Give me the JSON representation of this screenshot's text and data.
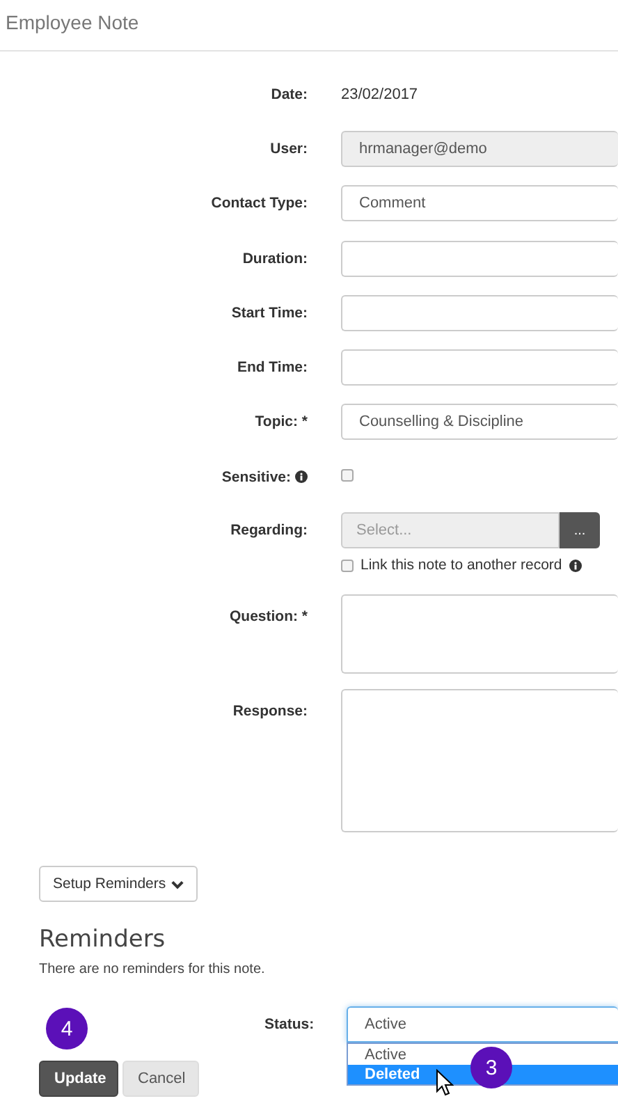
{
  "title": "Employee Note",
  "fields": [
    {
      "label": "Date:",
      "kind": "text",
      "value": "23/02/2017"
    },
    {
      "label": "User:",
      "kind": "readonly",
      "value": "hrmanager@demo"
    },
    {
      "label": "Contact Type:",
      "kind": "input",
      "value": "Comment"
    },
    {
      "label": "Duration:",
      "kind": "input"
    },
    {
      "label": "Start Time:",
      "kind": "input"
    },
    {
      "label": "End Time:",
      "kind": "input"
    },
    {
      "label": "Topic: *",
      "kind": "input",
      "value": "Counselling & Discipline"
    },
    {
      "label": "Sensitive:",
      "kind": "checkbox",
      "info": true,
      "checked": false
    },
    {
      "label": "Regarding:",
      "kind": "lookup",
      "placeholder": "Select...",
      "button": "...",
      "link_label": "Link this note to another record",
      "link_checked": false
    },
    {
      "label": "Question: *",
      "kind": "textarea"
    },
    {
      "label": "Response:",
      "kind": "bigtextarea"
    }
  ],
  "setup_button": "Setup Reminders",
  "reminders": {
    "heading": "Reminders",
    "text": "There are no reminders for this note."
  },
  "status": {
    "label": "Status:",
    "value": "Active",
    "options": [
      {
        "label": "Active",
        "highlighted": false
      },
      {
        "label": "Deleted",
        "highlighted": true
      }
    ]
  },
  "buttons": [
    {
      "label": "Update",
      "kind": "primary"
    },
    {
      "label": "Cancel",
      "kind": "secondary"
    }
  ],
  "steps": [
    {
      "label": "4"
    },
    {
      "label": "3"
    }
  ]
}
